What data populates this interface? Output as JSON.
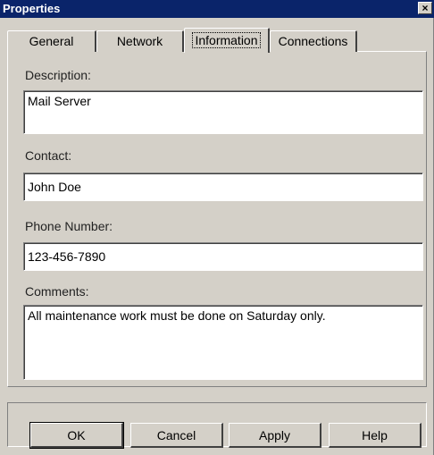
{
  "window": {
    "title": "Properties",
    "close_glyph": "×"
  },
  "tabs": [
    {
      "label": "General"
    },
    {
      "label": "Network"
    },
    {
      "label": "Information",
      "active": true
    },
    {
      "label": "Connections"
    }
  ],
  "form": {
    "description": {
      "label": "Description:",
      "value": "Mail Server"
    },
    "contact": {
      "label": "Contact:",
      "value": "John Doe"
    },
    "phone": {
      "label": "Phone Number:",
      "value": "123-456-7890"
    },
    "comments": {
      "label": "Comments:",
      "value": "All maintenance work must be done on Saturday only."
    }
  },
  "buttons": {
    "ok": "OK",
    "cancel": "Cancel",
    "apply": "Apply",
    "help": "Help"
  },
  "colors": {
    "titlebar": "#0a246a",
    "face": "#d4d0c8"
  }
}
